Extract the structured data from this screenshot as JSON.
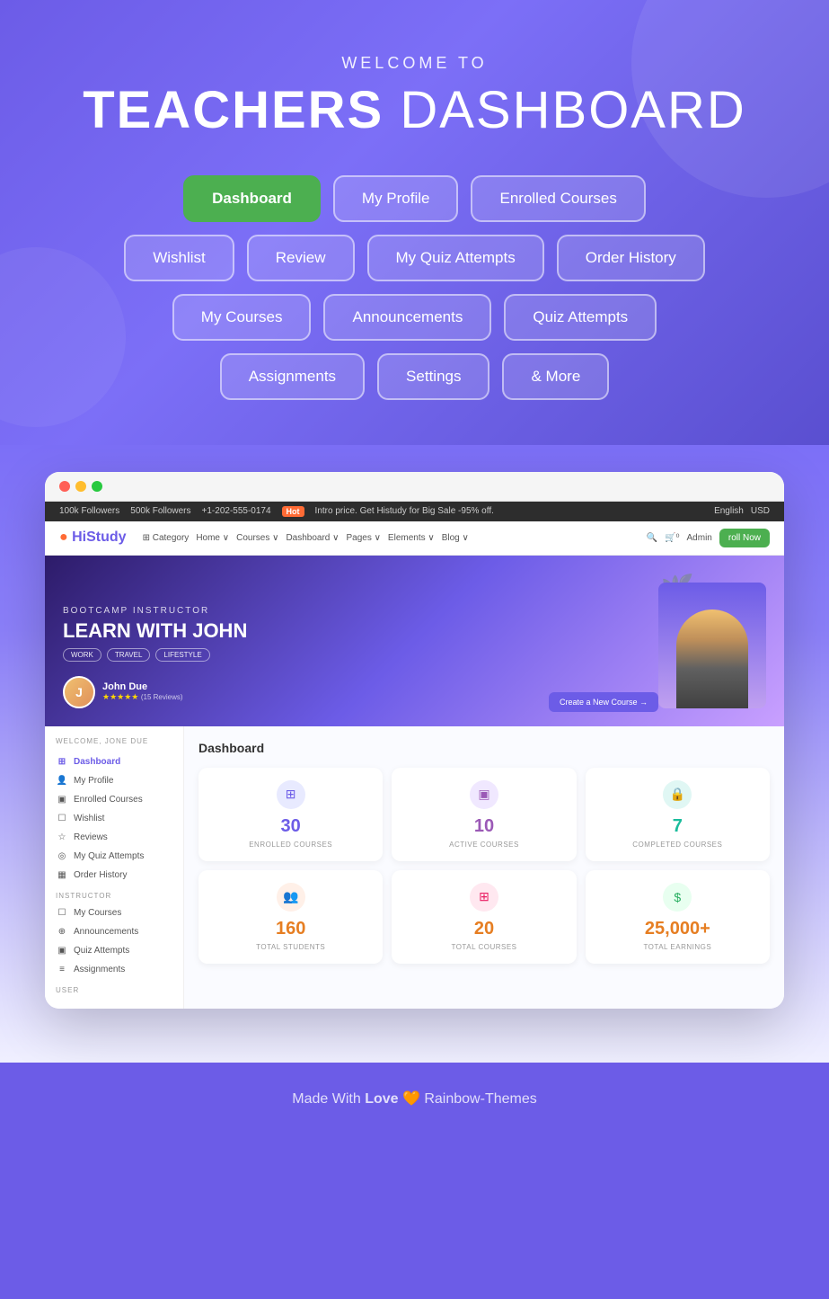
{
  "hero": {
    "welcome": "WELCOME TO",
    "title_bold": "TEACHERS",
    "title_light": " DASHBOARD"
  },
  "nav_buttons": {
    "row1": [
      {
        "label": "Dashboard",
        "active": true
      },
      {
        "label": "My Profile",
        "active": false
      },
      {
        "label": "Enrolled Courses",
        "active": false
      }
    ],
    "row2": [
      {
        "label": "Wishlist",
        "active": false
      },
      {
        "label": "Review",
        "active": false
      },
      {
        "label": "My Quiz Attempts",
        "active": false
      },
      {
        "label": "Order History",
        "active": false
      }
    ],
    "row3": [
      {
        "label": "My Courses",
        "active": false
      },
      {
        "label": "Announcements",
        "active": false
      },
      {
        "label": "Quiz Attempts",
        "active": false
      }
    ],
    "row4": [
      {
        "label": "Assignments",
        "active": false
      },
      {
        "label": "Settings",
        "active": false
      },
      {
        "label": "& More",
        "active": false
      }
    ]
  },
  "topbar": {
    "followers_fb": "100k Followers",
    "followers_in": "500k Followers",
    "phone": "+1-202-555-0174",
    "hot_label": "Hot",
    "promo": "Intro price. Get Histudy for Big Sale -95% off.",
    "language": "English",
    "currency": "USD"
  },
  "sitenav": {
    "logo": "HiStudy",
    "links": [
      "Category",
      "Home",
      "Courses",
      "Dashboard",
      "Pages",
      "Elements",
      "Blog"
    ],
    "admin": "Admin",
    "enroll": "roll Now"
  },
  "banner": {
    "subtitle": "BOOTCAMP INSTRUCTOR",
    "title": "LEARN WITH JOHN",
    "tags": [
      "WORK",
      "TRAVEL",
      "LIFESTYLE"
    ],
    "instructor_name": "John Due",
    "reviews": "(15 Reviews)",
    "create_btn": "Create a New Course →"
  },
  "sidebar": {
    "welcome": "WELCOME, JONE DUE",
    "student_items": [
      {
        "icon": "⊞",
        "label": "Dashboard",
        "active": true
      },
      {
        "icon": "👤",
        "label": "My Profile",
        "active": false
      },
      {
        "icon": "▣",
        "label": "Enrolled Courses",
        "active": false
      },
      {
        "icon": "☐",
        "label": "Wishlist",
        "active": false
      },
      {
        "icon": "☆",
        "label": "Reviews",
        "active": false
      },
      {
        "icon": "◎",
        "label": "My Quiz Attempts",
        "active": false
      },
      {
        "icon": "▦",
        "label": "Order History",
        "active": false
      }
    ],
    "instructor_label": "INSTRUCTOR",
    "instructor_items": [
      {
        "icon": "☐",
        "label": "My Courses",
        "active": false
      },
      {
        "icon": "⊕",
        "label": "Announcements",
        "active": false
      },
      {
        "icon": "▣",
        "label": "Quiz Attempts",
        "active": false
      },
      {
        "icon": "≡",
        "label": "Assignments",
        "active": false
      }
    ],
    "other_label": "USER"
  },
  "dashboard": {
    "title": "Dashboard",
    "stats": [
      {
        "icon": "⊞",
        "icon_type": "blue",
        "value": "30",
        "value_color": "blue-text",
        "label": "ENROLLED COURSES"
      },
      {
        "icon": "▣",
        "icon_type": "purple",
        "value": "10",
        "value_color": "purple-text",
        "label": "ACTIVE COURSES"
      },
      {
        "icon": "🔒",
        "icon_type": "teal",
        "value": "7",
        "value_color": "teal-text",
        "label": "COMPLETED COURSES"
      },
      {
        "icon": "👥",
        "icon_type": "orange",
        "value": "160",
        "value_color": "orange-text",
        "label": "TOTAL STUDENTS"
      },
      {
        "icon": "⊞",
        "icon_type": "pink",
        "value": "20",
        "value_color": "orange-text",
        "label": "TOTAL COURSES"
      },
      {
        "icon": "$",
        "icon_type": "green",
        "value": "25,000+",
        "value_color": "orange-text",
        "label": "TOTAL EARNINGS"
      }
    ]
  },
  "footer": {
    "text_start": "Made With ",
    "text_bold": "Love",
    "heart": "🧡",
    "text_end": " Rainbow-Themes"
  }
}
